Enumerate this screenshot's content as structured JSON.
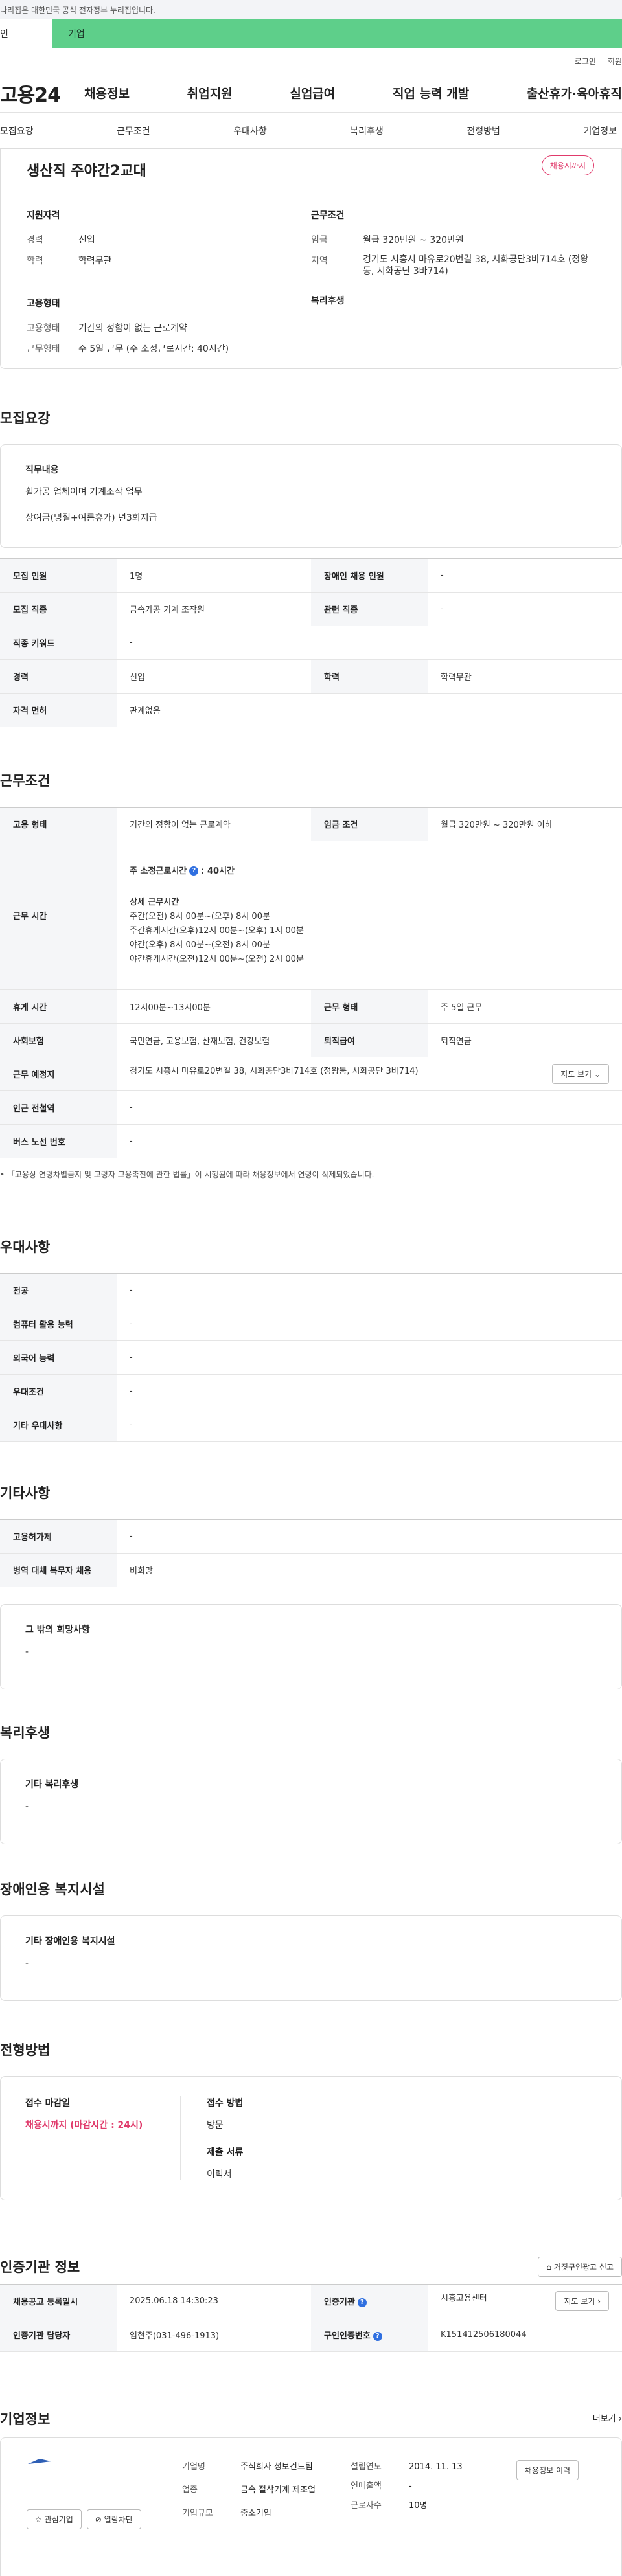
{
  "topbar": {
    "notice": "나리집은 대한민국 공식 전자정부 누리집입니다."
  },
  "greenbar": {
    "left": "인",
    "right": "기업"
  },
  "util": {
    "login": "로그인",
    "join": "회원"
  },
  "gnb": {
    "logo": "고용24",
    "menu": [
      "채용정보",
      "취업지원",
      "실업급여",
      "직업 능력 개발",
      "출산휴가·육아휴직"
    ]
  },
  "tabs": [
    "모집요강",
    "근무조건",
    "우대사항",
    "복리후생",
    "전형방법",
    "기업정보"
  ],
  "summary": {
    "title": "생산직 주야간2교대",
    "badge": "채용시까지",
    "qual_h": "지원자격",
    "exp_k": "경력",
    "exp_v": "신입",
    "edu_k": "학력",
    "edu_v": "학력무관",
    "emp_h": "고용형태",
    "emp_k": "고용형태",
    "emp_v": "기간의 정함이 없는 근로계약",
    "work_k": "근무형태",
    "work_v": "주 5일 근무 (주 소정근로시간: 40시간)",
    "cond_h": "근무조건",
    "wage_k": "임금",
    "wage_v": "월급 320만원 ~ 320만원",
    "area_k": "지역",
    "area_v": "경기도 시흥시 마유로20번길 38, 시화공단3바714호 (정왕동, 시화공단 3바714)",
    "welfare_h": "복리후생"
  },
  "recruit": {
    "title": "모집요강",
    "job_h": "직무내용",
    "job_v1": "휠가공 업체이며 기계조작 업무",
    "job_v2": "상여금(명절+여름휴가) 년3회지급",
    "rows": [
      [
        "모집 인원",
        "1명",
        "장애인 채용 인원",
        "-"
      ],
      [
        "모집 직종",
        "금속가공 기계 조작원",
        "관련 직종",
        "-"
      ],
      [
        "직종 키워드",
        "-"
      ],
      [
        "경력",
        "신입",
        "학력",
        "학력무관"
      ],
      [
        "자격 면허",
        "관계없음"
      ]
    ]
  },
  "work": {
    "title": "근무조건",
    "r1": [
      "고용 형태",
      "기간의 정함이 없는 근로계약",
      "임금 조건",
      "월급 320만원 ~ 320만원 이하"
    ],
    "hours_h": "근무 시간",
    "hours_main": "주 소정근로시간",
    "hours_main_v": ": 40시간",
    "hours_detail_h": "상세 근무시간",
    "hours_lines": [
      "주간(오전) 8시 00분~(오후) 8시 00분",
      "주간휴게시간(오후)12시 00분~(오후) 1시 00분",
      "야간(오후) 8시 00분~(오전) 8시 00분",
      "야간휴게시간(오전)12시 00분~(오전) 2시 00분"
    ],
    "r3": [
      "휴게 시간",
      "12시00분~13시00분",
      "근무 형태",
      "주 5일 근무"
    ],
    "r4": [
      "사회보험",
      "국민연금, 고용보험, 산재보험, 건강보험",
      "퇴직급여",
      "퇴직연금"
    ],
    "r5": [
      "근무 예정지",
      "경기도 시흥시 마유로20번길 38, 시화공단3바714호 (정왕동, 시화공단 3바714)"
    ],
    "map_btn": "지도 보기",
    "r6": [
      "인근 전철역",
      "-"
    ],
    "r7": [
      "버스 노선 번호",
      "-"
    ],
    "note": "「고용상 연령차별금지 및 고령자 고용촉진에 관한 법률」이 시행됨에 따라 채용정보에서 연령이 삭제되었습니다."
  },
  "pref": {
    "title": "우대사항",
    "rows": [
      [
        "전공",
        "-"
      ],
      [
        "컴퓨터 활용 능력",
        "-"
      ],
      [
        "외국어 능력",
        "-"
      ],
      [
        "우대조건",
        "-"
      ],
      [
        "기타 우대사항",
        "-"
      ]
    ]
  },
  "etc": {
    "title": "기타사항",
    "rows": [
      [
        "고용허가제",
        "-"
      ],
      [
        "병역 대체 복무자 채용",
        "비희망"
      ]
    ],
    "hope_h": "그 밖의 희망사항",
    "hope_v": "-"
  },
  "welfare": {
    "title": "복리후생",
    "h": "기타 복리후생",
    "v": "-"
  },
  "disabled": {
    "title": "장애인용 복지시설",
    "h": "기타 장애인용 복지시설",
    "v": "-"
  },
  "process": {
    "title": "전형방법",
    "deadline_h": "접수 마감일",
    "deadline_v": "채용시까지 (마감시간 : 24시)",
    "method_h": "접수 방법",
    "method_v": "방문",
    "docs_h": "제출 서류",
    "docs_v": "이력서"
  },
  "cert": {
    "title": "인증기관 정보",
    "report_btn": "거짓구인광고 신고",
    "rows": [
      [
        "채용공고 등록일시",
        "2025.06.18 14:30:23",
        "인증기관",
        "시흥고용센터"
      ],
      [
        "인증기관 담당자",
        "임현주(031-496-1913)",
        "구인인증번호",
        "K151412506180044"
      ]
    ],
    "map_btn": "지도 보기"
  },
  "company": {
    "title": "기업정보",
    "more": "더보기",
    "name_k": "기업명",
    "name_v": "주식회사 성보건드팀",
    "ind_k": "업종",
    "ind_v": "금속 절삭기계 제조업",
    "size_k": "기업규모",
    "size_v": "중소기업",
    "est_k": "설립연도",
    "est_v": "2014. 11. 13",
    "sales_k": "연매출액",
    "sales_v": "-",
    "emp_k": "근로자수",
    "emp_v": "10명",
    "fav_btn": "관심기업",
    "block_btn": "열람차단",
    "info_btn": "채용정보 이력"
  }
}
